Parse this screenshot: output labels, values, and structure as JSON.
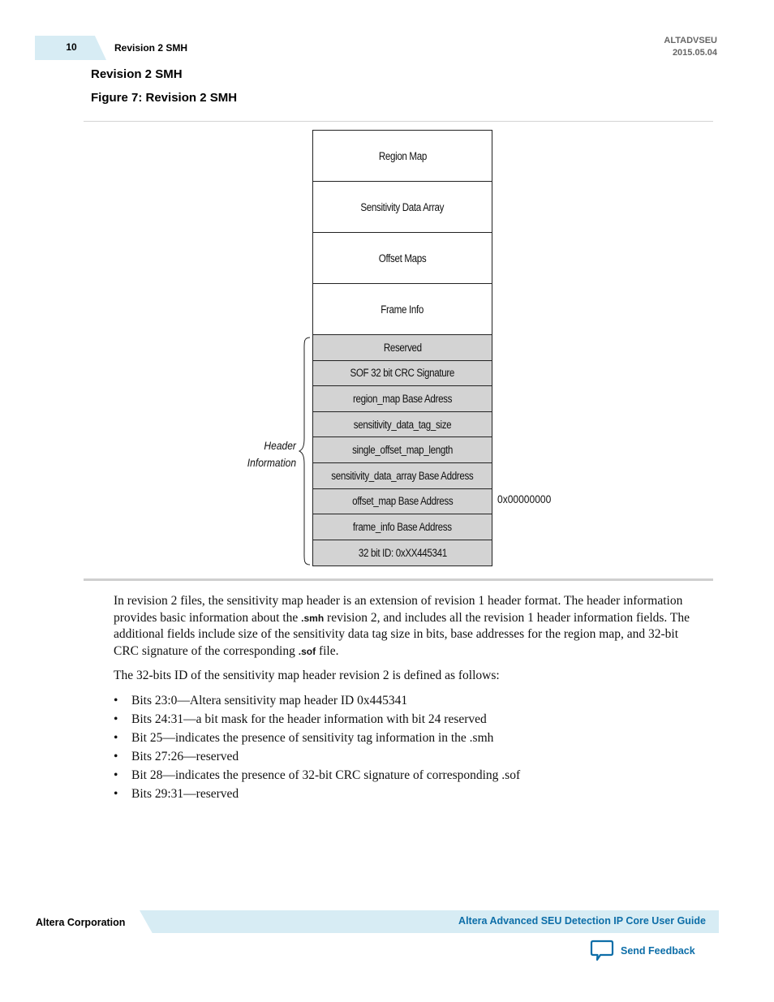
{
  "header": {
    "page_number": "10",
    "section": "Revision 2 SMH",
    "doc_id": "ALTADVSEU",
    "date": "2015.05.04"
  },
  "section_title": "Revision 2 SMH",
  "figure_title": "Figure 7: Revision 2 SMH",
  "diagram": {
    "main_blocks": [
      "Region Map",
      "Sensitivity Data Array",
      "Offset Maps",
      "Frame Info"
    ],
    "header_fields": [
      "Reserved",
      "SOF 32 bit CRC Signature",
      "region_map Base Adress",
      "sensitivity_data_tag_size",
      "single_offset_map_length",
      "sensitivity_data_array Base Address",
      "offset_map Base Address",
      "frame_info Base Address",
      "32 bit ID: 0xXX445341"
    ],
    "brace_label_line1": "Header",
    "brace_label_line2": "Information",
    "address_label": "0x00000000"
  },
  "body": {
    "para1_part1": "In revision 2 files, the sensitivity map header is an extension of revision 1 header format. The header information provides basic information about the ",
    "para1_code1": ".smh",
    "para1_part2": " revision 2, and includes all the revision 1 header information fields. The additional fields include size of the sensitivity data tag size in bits, base addresses for the region map, and 32-bit CRC signature of the corresponding ",
    "para1_code2": ".sof",
    "para1_part3": " file.",
    "para2": "The 32-bits ID of the sensitivity map header revision 2 is defined as follows:",
    "bullets": [
      "Bits 23:0—Altera sensitivity map header ID 0x445341",
      "Bits 24:31—a bit mask for the header information with bit 24 reserved",
      "Bit 25—indicates the presence of sensitivity tag information in the .smh",
      "Bits 27:26—reserved",
      "Bit 28—indicates the presence of 32-bit CRC signature of corresponding .sof",
      "Bits 29:31—reserved"
    ]
  },
  "footer": {
    "company": "Altera Corporation",
    "guide_title": "Altera Advanced SEU Detection IP Core User Guide",
    "feedback_label": "Send Feedback",
    "feedback_icon": "speech-bubble-icon"
  },
  "colors": {
    "accent_band": "#d7ecf4",
    "link_blue": "#0d6ea8",
    "header_cell_gray": "#d3d3d3"
  }
}
